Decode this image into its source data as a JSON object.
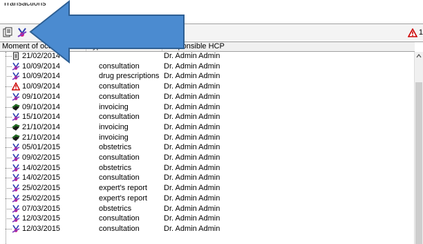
{
  "window": {
    "title": "Transactions"
  },
  "toolbar": {
    "alert_count": "1"
  },
  "grid": {
    "columns": [
      "Moment of occurrence",
      "Type",
      "Responsible HCP"
    ],
    "rows": [
      {
        "icon": "document-icon",
        "date": "21/02/2014",
        "type": "",
        "hcp": "Dr. Admin Admin"
      },
      {
        "icon": "stethoscope-icon",
        "date": "10/09/2014",
        "type": "consultation",
        "hcp": "Dr. Admin Admin"
      },
      {
        "icon": "stethoscope-icon",
        "date": "10/09/2014",
        "type": "drug prescriptions",
        "hcp": "Dr. Admin Admin"
      },
      {
        "icon": "warning-icon",
        "date": "10/09/2014",
        "type": "consultation",
        "hcp": "Dr. Admin Admin"
      },
      {
        "icon": "stethoscope-icon",
        "date": "09/10/2014",
        "type": "consultation",
        "hcp": "Dr. Admin Admin"
      },
      {
        "icon": "invoice-icon",
        "date": "09/10/2014",
        "type": "invoicing",
        "hcp": "Dr. Admin Admin"
      },
      {
        "icon": "stethoscope-icon",
        "date": "15/10/2014",
        "type": "consultation",
        "hcp": "Dr. Admin Admin"
      },
      {
        "icon": "invoice-icon",
        "date": "21/10/2014",
        "type": "invoicing",
        "hcp": "Dr. Admin Admin"
      },
      {
        "icon": "invoice-icon",
        "date": "21/10/2014",
        "type": "invoicing",
        "hcp": "Dr. Admin Admin"
      },
      {
        "icon": "stethoscope-icon",
        "date": "05/01/2015",
        "type": "obstetrics",
        "hcp": "Dr. Admin Admin"
      },
      {
        "icon": "stethoscope-icon",
        "date": "09/02/2015",
        "type": "consultation",
        "hcp": "Dr. Admin Admin"
      },
      {
        "icon": "stethoscope-icon",
        "date": "14/02/2015",
        "type": "obstetrics",
        "hcp": "Dr. Admin Admin"
      },
      {
        "icon": "stethoscope-icon",
        "date": "14/02/2015",
        "type": "consultation",
        "hcp": "Dr. Admin Admin"
      },
      {
        "icon": "stethoscope-icon",
        "date": "25/02/2015",
        "type": "expert's report",
        "hcp": "Dr. Admin Admin"
      },
      {
        "icon": "stethoscope-icon",
        "date": "25/02/2015",
        "type": "expert's report",
        "hcp": "Dr. Admin Admin"
      },
      {
        "icon": "stethoscope-icon",
        "date": "07/03/2015",
        "type": "obstetrics",
        "hcp": "Dr. Admin Admin"
      },
      {
        "icon": "stethoscope-icon",
        "date": "12/03/2015",
        "type": "consultation",
        "hcp": "Dr. Admin Admin"
      },
      {
        "icon": "stethoscope-icon",
        "date": "12/03/2015",
        "type": "consultation",
        "hcp": "Dr. Admin Admin"
      }
    ]
  },
  "colors": {
    "arrow": "#4b8bd0",
    "arrow_stroke": "#2e5f93",
    "warning": "#cc0000",
    "invoice": "#2b8a2b"
  }
}
